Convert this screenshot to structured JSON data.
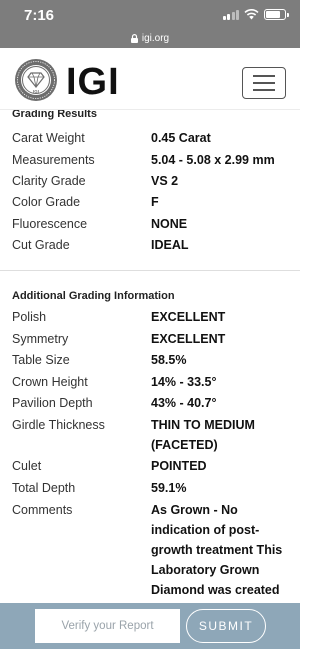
{
  "status_bar": {
    "time": "7:16"
  },
  "browser": {
    "url": "igi.org"
  },
  "header": {
    "logo_text": "IGI",
    "seal_text": "IGI"
  },
  "grading_results": {
    "title": "Grading Results",
    "rows": [
      {
        "label": "Carat Weight",
        "value": "0.45 Carat"
      },
      {
        "label": "Measurements",
        "value": "5.04 - 5.08 x 2.99 mm"
      },
      {
        "label": "Clarity Grade",
        "value": "VS 2"
      },
      {
        "label": "Color Grade",
        "value": "F"
      },
      {
        "label": "Fluorescence",
        "value": "NONE"
      },
      {
        "label": "Cut Grade",
        "value": "IDEAL"
      }
    ]
  },
  "additional": {
    "title": "Additional Grading Information",
    "rows": [
      {
        "label": "Polish",
        "value": "EXCELLENT"
      },
      {
        "label": "Symmetry",
        "value": "EXCELLENT"
      },
      {
        "label": "Table Size",
        "value": "58.5%"
      },
      {
        "label": "Crown Height",
        "value": "14% - 33.5°"
      },
      {
        "label": "Pavilion Depth",
        "value": "43% - 40.7°"
      },
      {
        "label": "Girdle Thickness",
        "value": "THIN TO MEDIUM (FACETED)"
      },
      {
        "label": "Culet",
        "value": "POINTED"
      },
      {
        "label": "Total Depth",
        "value": "59.1%"
      },
      {
        "label": "Comments",
        "value": "As Grown - No indication of post-growth treatment This Laboratory Grown Diamond was created"
      }
    ]
  },
  "verify": {
    "placeholder": "Verify your Report",
    "submit_label": "SUBMIT"
  },
  "colors": {
    "status_bar": "#7d7d7d",
    "verify_bar": "#8ea7b8"
  },
  "icons": [
    "lock-icon",
    "wifi-icon",
    "battery-icon",
    "signal-icon",
    "hamburger-menu-icon"
  ]
}
